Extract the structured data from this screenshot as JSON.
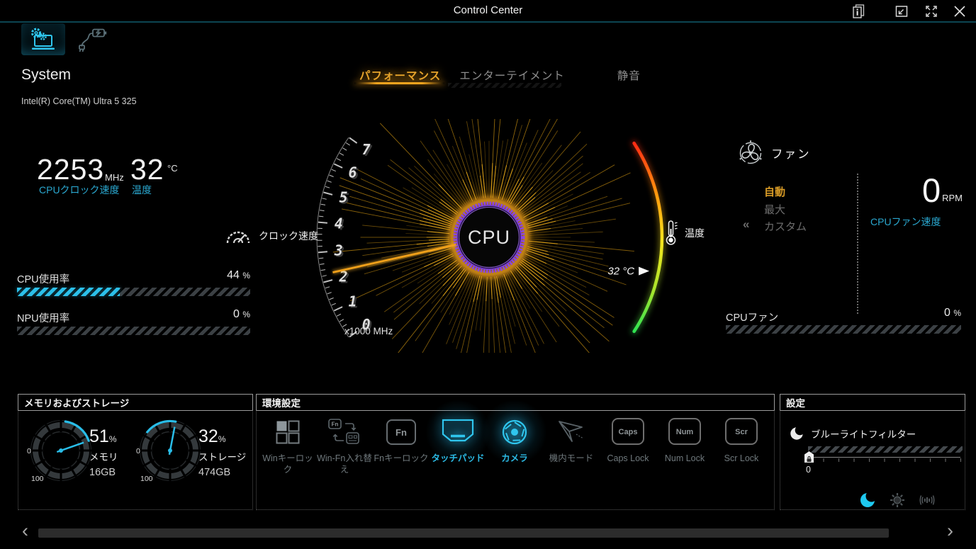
{
  "titlebar": {
    "title": "Control Center",
    "window_icons": [
      "info-pages-icon",
      "restore-icon",
      "expand-icon",
      "close-icon"
    ]
  },
  "nav": {
    "tabs": [
      {
        "icon": "system-settings-icon",
        "active": true
      },
      {
        "icon": "power-battery-icon",
        "active": false
      }
    ]
  },
  "system": {
    "heading": "System",
    "cpu_name": "Intel(R) Core(TM) Ultra 5 325"
  },
  "mode_tabs": [
    {
      "label": "パフォーマンス",
      "active": true
    },
    {
      "label": "エンターテイメント",
      "active": false
    },
    {
      "label": "静音",
      "active": false
    }
  ],
  "stats": {
    "clock": {
      "value": "2253",
      "unit": "MHz",
      "label": "CPUクロック速度"
    },
    "temp": {
      "value": "32",
      "unit": "°C",
      "label": "温度"
    }
  },
  "usage_bars": [
    {
      "label": "CPU使用率",
      "value": 44,
      "display": "44",
      "unit": "%"
    },
    {
      "label": "NPU使用率",
      "value": 0,
      "display": "0",
      "unit": "%"
    }
  ],
  "gauge": {
    "center_label": "CPU",
    "clock_mhz": 2253,
    "scale": {
      "min": 0,
      "max": 7,
      "unit_label": "x1000 MHz",
      "numbers": [
        "0",
        "1",
        "2",
        "3",
        "4",
        "5",
        "6",
        "7"
      ]
    },
    "clock_axis_label": "クロック速度",
    "temp_axis_label": "温度",
    "temp_c": 32,
    "temp_range": [
      0,
      100
    ],
    "temp_marker": "32 °C"
  },
  "fan": {
    "title": "ファン",
    "modes": [
      {
        "label": "自動",
        "active": true
      },
      {
        "label": "最大",
        "active": false
      },
      {
        "label": "カスタム",
        "active": false,
        "prefix": "«"
      }
    ],
    "speed": {
      "value": "0",
      "unit": "RPM",
      "label": "CPUファン速度"
    },
    "usage": {
      "label": "CPUファン",
      "value": 0,
      "display": "0",
      "unit": "%"
    }
  },
  "memory_panel": {
    "title": "メモリおよびストレージ",
    "gauges": [
      {
        "percent": 51,
        "display": "51",
        "unit": "%",
        "label": "メモリ",
        "capacity": "16GB",
        "scale_min": "0",
        "scale_max": "100"
      },
      {
        "percent": 32,
        "display": "32",
        "unit": "%",
        "label": "ストレージ",
        "capacity": "474GB",
        "scale_min": "0",
        "scale_max": "100"
      }
    ]
  },
  "env_panel": {
    "title": "環境設定",
    "items": [
      {
        "label": "Winキーロック",
        "icon": "windows-key-icon",
        "active": false
      },
      {
        "label": "Win-Fn入れ替え",
        "icon": "win-fn-swap-icon",
        "active": false
      },
      {
        "label": "Fnキーロック",
        "icon": "fn-key-icon",
        "active": false
      },
      {
        "label": "タッチパッド",
        "icon": "touchpad-icon",
        "active": true
      },
      {
        "label": "カメラ",
        "icon": "camera-icon",
        "active": true
      },
      {
        "label": "機内モード",
        "icon": "airplane-icon",
        "active": false
      },
      {
        "label": "Caps Lock",
        "icon": "caps-key-icon",
        "active": false,
        "key_text": "Caps"
      },
      {
        "label": "Num Lock",
        "icon": "num-key-icon",
        "active": false,
        "key_text": "Num"
      },
      {
        "label": "Scr Lock",
        "icon": "scr-key-icon",
        "active": false,
        "key_text": "Scr"
      }
    ],
    "key_labels": {
      "fn": "Fn"
    }
  },
  "settings_panel": {
    "title": "設定",
    "bluelight": {
      "label": "ブルーライトフィルター",
      "value": "0"
    },
    "footer_icons": [
      "moon-icon",
      "brightness-icon",
      "audio-icon"
    ]
  },
  "scrollbar": {
    "left": "‹",
    "right": "›"
  }
}
